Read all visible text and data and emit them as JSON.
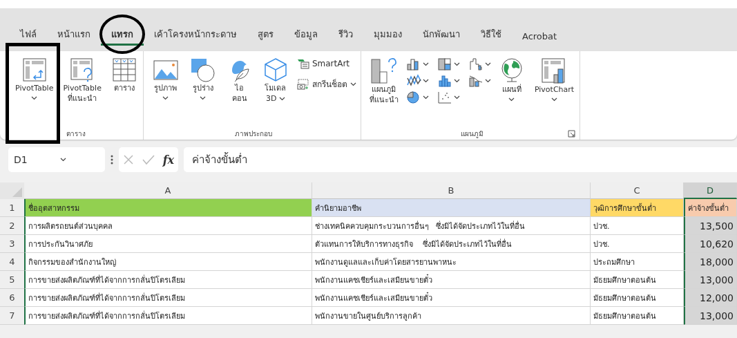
{
  "tabs": [
    {
      "label": "ไฟล์",
      "selected": false,
      "annotated": false
    },
    {
      "label": "หน้าแรก",
      "selected": false,
      "annotated": false
    },
    {
      "label": "แทรก",
      "selected": true,
      "annotated": true
    },
    {
      "label": "เค้าโครงหน้ากระดาษ",
      "selected": false,
      "annotated": false
    },
    {
      "label": "สูตร",
      "selected": false,
      "annotated": false
    },
    {
      "label": "ข้อมูล",
      "selected": false,
      "annotated": false
    },
    {
      "label": "รีวิว",
      "selected": false,
      "annotated": false
    },
    {
      "label": "มุมมอง",
      "selected": false,
      "annotated": false
    },
    {
      "label": "นักพัฒนา",
      "selected": false,
      "annotated": false
    },
    {
      "label": "วิธีใช้",
      "selected": false,
      "annotated": false
    },
    {
      "label": "Acrobat",
      "selected": false,
      "annotated": false
    }
  ],
  "ribbon": {
    "groups": [
      {
        "label": "ตาราง",
        "launcher": false,
        "items": [
          {
            "kind": "large",
            "lines": [
              "PivotTable"
            ],
            "dropdown": true,
            "annotated": true
          },
          {
            "kind": "large",
            "lines": [
              "PivotTable",
              "ที่แนะนำ"
            ],
            "dropdown": false,
            "annotated": false
          },
          {
            "kind": "large",
            "lines": [
              "ตาราง"
            ],
            "dropdown": false,
            "annotated": false
          }
        ]
      },
      {
        "label": "ภาพประกอบ",
        "launcher": false,
        "items": [
          {
            "kind": "large",
            "lines": [
              "รูปภาพ"
            ],
            "dropdown": true,
            "annotated": false
          },
          {
            "kind": "large",
            "lines": [
              "รูปร่าง"
            ],
            "dropdown": true,
            "annotated": false
          },
          {
            "kind": "large",
            "lines": [
              "ไอ",
              "คอน"
            ],
            "dropdown": false,
            "annotated": false
          },
          {
            "kind": "large",
            "lines": [
              "โมเดล",
              "3D"
            ],
            "dropdown": true,
            "annotated": false
          },
          {
            "kind": "stack",
            "entries": [
              {
                "label": "SmartArt",
                "dropdown": false
              },
              {
                "label": "สกรีนช็อต",
                "dropdown": true
              }
            ]
          }
        ]
      },
      {
        "label": "แผนภูมิ",
        "launcher": true,
        "items": [
          {
            "kind": "large",
            "lines": [
              "แผนภูมิ",
              "ที่แนะนำ"
            ],
            "dropdown": false,
            "annotated": false
          },
          {
            "kind": "chart-gallery"
          },
          {
            "kind": "large",
            "lines": [
              "แผนที่"
            ],
            "dropdown": true,
            "annotated": false
          },
          {
            "kind": "large",
            "lines": [
              "PivotChart"
            ],
            "dropdown": true,
            "annotated": false
          }
        ]
      }
    ]
  },
  "formula_bar": {
    "name_box": "D1",
    "function_button": "fx",
    "formula": "ค่าจ้างขั้นต่ำ"
  },
  "sheet": {
    "columns": [
      {
        "label": "A",
        "color": "#92d050",
        "selected": false
      },
      {
        "label": "B",
        "color": "#d9e1f2",
        "selected": false
      },
      {
        "label": "C",
        "color": "#ffd966",
        "selected": false
      },
      {
        "label": "D",
        "color": "#f8cbad",
        "selected": true
      }
    ],
    "rows": [
      {
        "number": "1",
        "cells": [
          "ชื่ออุตสาหกรรม",
          "คำนิยามอาชีพ",
          "วุฒิการศึกษาขั้นต่ำ",
          "ค่าจ้างขั้นต่ำ"
        ]
      },
      {
        "number": "2",
        "cells": [
          "การผลิตรถยนต์ส่วนบุคคล",
          "ช่างเทคนิคควบคุมกระบวนการอื่นๆ   ซึ่งมิได้จัดประเภทไว้ในที่อื่น",
          "ปวช.",
          "13,500"
        ]
      },
      {
        "number": "3",
        "cells": [
          "การประกันวินาศภัย",
          "ตัวแทนการให้บริการทางธุรกิจ    ซึ่งมิได้จัดประเภทไว้ในที่อื่น",
          "ปวช.",
          "10,620"
        ]
      },
      {
        "number": "4",
        "cells": [
          "กิจกรรมของสำนักงานใหญ่",
          "พนักงานดูแลและเก็บค่าโดยสารยานพาหนะ",
          "ประถมศึกษา",
          "18,000"
        ]
      },
      {
        "number": "5",
        "cells": [
          "การขายส่งผลิตภัณฑ์ที่ได้จากการกลั่นปิโตรเลียม",
          "พนักงานแคชเชียร์และเสมียนขายตั๋ว",
          "มัธยมศึกษาตอนต้น",
          "13,000"
        ]
      },
      {
        "number": "6",
        "cells": [
          "การขายส่งผลิตภัณฑ์ที่ได้จากการกลั่นปิโตรเลียม",
          "พนักงานแคชเชียร์และเสมียนขายตั๋ว",
          "มัธยมศึกษาตอนต้น",
          "12,000"
        ]
      },
      {
        "number": "7",
        "cells": [
          "การขายส่งผลิตภัณฑ์ที่ได้จากการกลั่นปิโตรเลียม",
          "พนักงานขายในศูนย์บริการลูกค้า",
          "มัธยมศึกษาตอนต้น",
          "13,000"
        ]
      }
    ]
  }
}
